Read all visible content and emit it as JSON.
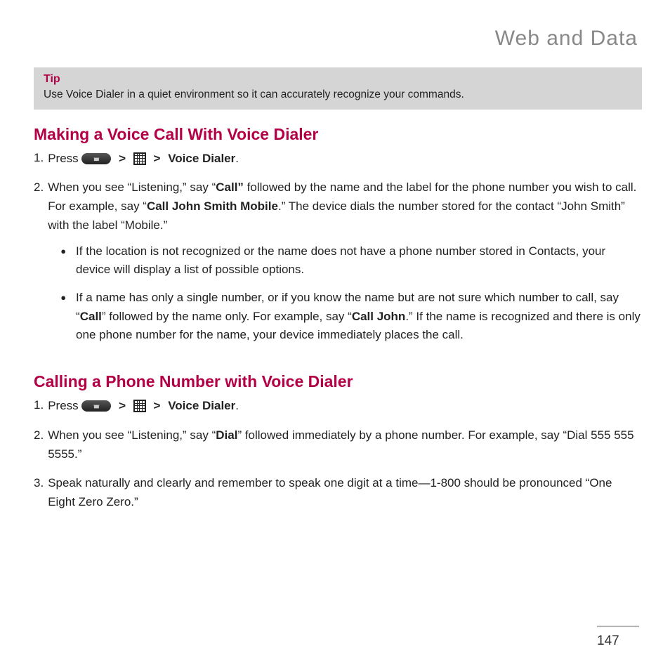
{
  "header": {
    "title": "Web and Data"
  },
  "tip": {
    "label": "Tip",
    "text": "Use Voice Dialer in a quiet environment so it can accurately recognize your commands."
  },
  "section1": {
    "heading": "Making a Voice Call With Voice Dialer",
    "step1_a": "Press ",
    "step1_sep1": ">",
    "step1_sep2": ">",
    "step1_b": "Voice Dialer",
    "step1_c": ".",
    "step2_a": "When you see “Listening,” say “",
    "step2_b": "Call”",
    "step2_c": " followed by the name and the label for the phone number you wish to call. For example, say “",
    "step2_d": "Call John Smith Mobile",
    "step2_e": ".” The device dials the number stored for the contact “John Smith” with the label “Mobile.”",
    "bullet1": "If the location is not recognized or the name does not have a phone number stored in Contacts, your device will display a list of possible options.",
    "bullet2_a": "If a name has only a single number, or if you know the name but are not sure which number to call, say “",
    "bullet2_b": "Call",
    "bullet2_c": "” followed by the name only. For example, say “",
    "bullet2_d": "Call John",
    "bullet2_e": ".” If the name is recognized and there is only one phone number for the name, your device immediately places the call."
  },
  "section2": {
    "heading": "Calling a Phone Number with Voice Dialer",
    "step1_a": "Press ",
    "step1_sep1": ">",
    "step1_sep2": ">",
    "step1_b": "Voice Dialer",
    "step1_c": ".",
    "step2_a": "When you see “Listening,” say “",
    "step2_b": "Dial",
    "step2_c": "” followed immediately by a phone number. For example, say “Dial 555 555 5555.”",
    "step3": "Speak naturally and clearly and remember to speak one digit at a time—1-800 should be pronounced “One Eight Zero Zero.”"
  },
  "page_number": "147"
}
